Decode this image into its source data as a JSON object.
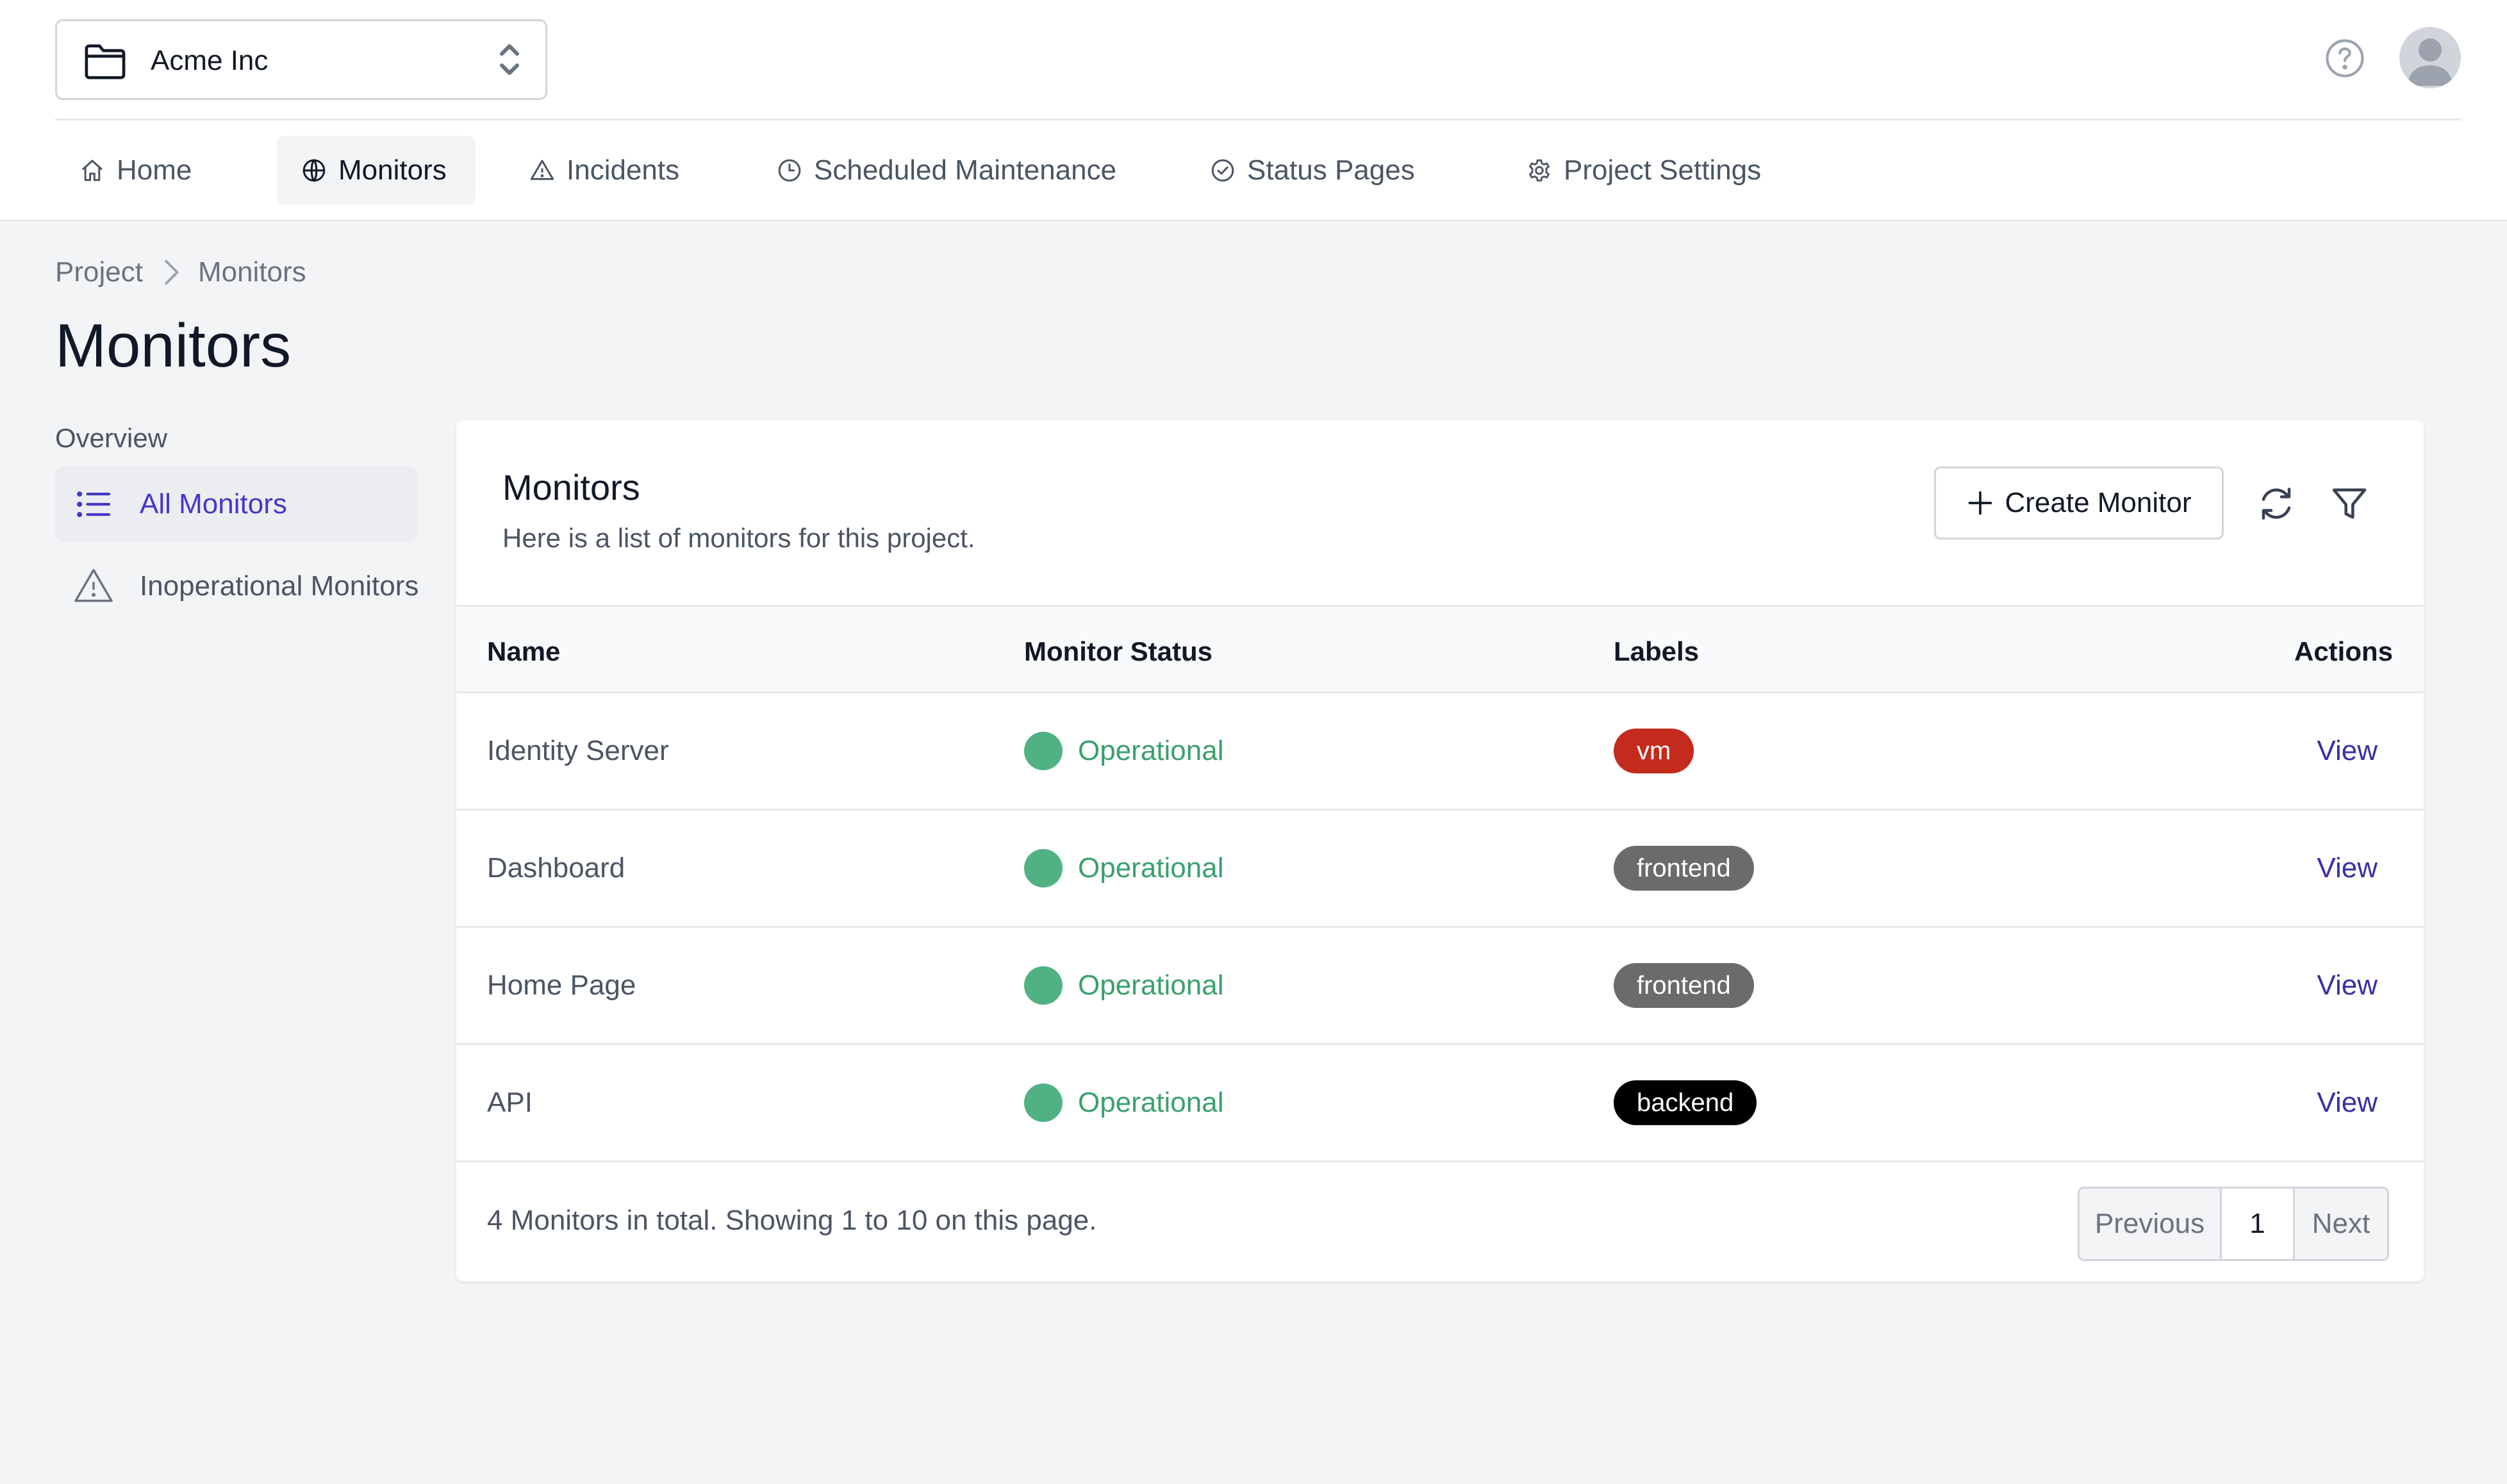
{
  "project": {
    "name": "Acme Inc"
  },
  "nav": [
    {
      "label": "Home"
    },
    {
      "label": "Monitors"
    },
    {
      "label": "Incidents"
    },
    {
      "label": "Scheduled Maintenance"
    },
    {
      "label": "Status Pages"
    },
    {
      "label": "Project Settings"
    }
  ],
  "breadcrumb": [
    "Project",
    "Monitors"
  ],
  "page_title": "Monitors",
  "sidebar": {
    "heading": "Overview",
    "items": [
      {
        "label": "All Monitors",
        "icon": "list-icon"
      },
      {
        "label": "Inoperational Monitors",
        "icon": "warning-icon"
      }
    ]
  },
  "card": {
    "title": "Monitors",
    "subtitle": "Here is a list of monitors for this project.",
    "create_label": "Create Monitor"
  },
  "table": {
    "columns": [
      "Name",
      "Monitor Status",
      "Labels",
      "Actions"
    ],
    "rows": [
      {
        "name": "Identity Server",
        "status": "Operational",
        "label": "vm",
        "label_color": "#c42b1c",
        "action": "View"
      },
      {
        "name": "Dashboard",
        "status": "Operational",
        "label": "frontend",
        "label_color": "#6b6b6b",
        "action": "View"
      },
      {
        "name": "Home Page",
        "status": "Operational",
        "label": "frontend",
        "label_color": "#6b6b6b",
        "action": "View"
      },
      {
        "name": "API",
        "status": "Operational",
        "label": "backend",
        "label_color": "#000000",
        "action": "View"
      }
    ],
    "footer_text": "4 Monitors in total. Showing 1 to 10 on this page."
  },
  "pagination": {
    "previous": "Previous",
    "page": "1",
    "next": "Next"
  },
  "colors": {
    "operational": "#50b283",
    "operational_text": "#3aa06c",
    "accent": "#4338ca"
  }
}
